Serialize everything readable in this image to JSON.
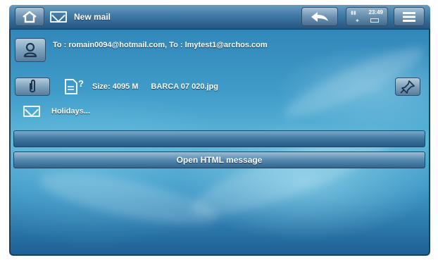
{
  "header": {
    "title": "New mail",
    "status_time": "23:49",
    "buttons": {
      "home": "home-icon",
      "mail": "envelope-icon",
      "back": "back-arrow-icon",
      "menu": "menu-icon"
    }
  },
  "recipients": {
    "text": "To : romain0094@hotmail.com, To : lmytest1@archos.com",
    "icon": "contact-icon"
  },
  "attachment": {
    "clip_icon": "paperclip-icon",
    "file_icon": "unknown-file-icon",
    "size_text": "Size: 4095 M",
    "filename": "BARCA 07 020.jpg",
    "pin_icon": "pin-icon"
  },
  "subject": {
    "icon": "envelope-icon",
    "text": "Holidays..."
  },
  "body_bar": {
    "text": ""
  },
  "open_html": {
    "label": "Open HTML message"
  },
  "colors": {
    "background_top": "#2d7fb3",
    "background_mid": "#5db6d8",
    "accent_bar": "#3e77a1"
  }
}
